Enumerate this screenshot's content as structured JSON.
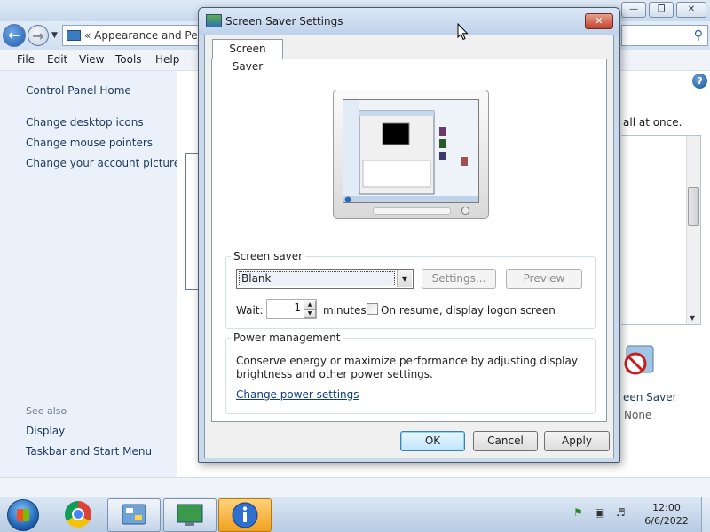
{
  "explorer": {
    "address_text": "Appearance and Personalization",
    "menu": {
      "file": "File",
      "edit": "Edit",
      "view": "View",
      "tools": "Tools",
      "help": "Help"
    },
    "sidebar": {
      "home": "Control Panel Home",
      "links": [
        "Change desktop icons",
        "Change mouse pointers",
        "Change your account picture"
      ],
      "see_also": "See also",
      "see_also_links": [
        "Display",
        "Taskbar and Start Menu"
      ]
    },
    "main": {
      "partial_text": "all at once.",
      "screen_saver_tile_label": "een Saver",
      "screen_saver_tile_value": "None"
    }
  },
  "dialog": {
    "title": "Screen Saver Settings",
    "tab": "Screen Saver",
    "screen_saver": {
      "group_label": "Screen saver",
      "selected": "Blank",
      "settings_button": "Settings...",
      "preview_button": "Preview",
      "wait_label": "Wait:",
      "wait_value": "1",
      "minutes_label": "minutes",
      "logon_checkbox_label": "On resume, display logon screen",
      "logon_checked": false
    },
    "power": {
      "group_label": "Power management",
      "description": "Conserve energy or maximize performance by adjusting display brightness and other power settings.",
      "link": "Change power settings"
    },
    "buttons": {
      "ok": "OK",
      "cancel": "Cancel",
      "apply": "Apply"
    }
  },
  "taskbar": {
    "time": "12:00",
    "date": "6/6/2022"
  },
  "colors": {
    "link": "#1e395b",
    "hyperlink": "#0c3c8c",
    "sidebar_bg": "#eaf1fb",
    "close_button": "#c2412b"
  }
}
